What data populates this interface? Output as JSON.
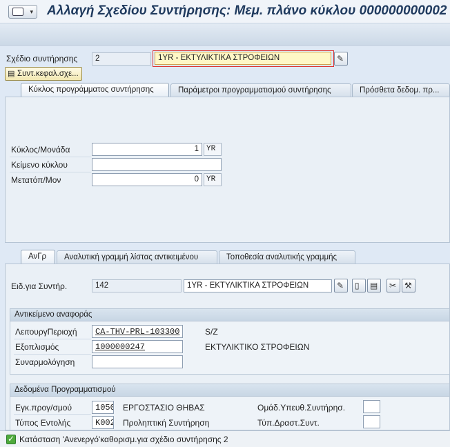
{
  "window": {
    "title": "Αλλαγή Σχεδίου Συντήρησης: Μεμ. πλάνο κύκλου 000000000002"
  },
  "header": {
    "plan_label": "Σχέδιο συντήρησης",
    "plan_number": "2",
    "plan_text": "1YR - ΕΚΤΥΛΙΚΤΙΚΑ ΣΤΡΟΦΕΙΩΝ",
    "header_button": "Συντ.κεφαλ.σχε..."
  },
  "tabs": [
    {
      "label": "Κύκλος προγράμματος συντήρησης"
    },
    {
      "label": "Παράμετροι προγραμματισμού συντήρησης"
    },
    {
      "label": "Πρόσθετα δεδομ. πρ..."
    }
  ],
  "cycle": {
    "cycle_label": "Κύκλος/Μονάδα",
    "cycle_value": "1",
    "cycle_unit": "YR",
    "text_label": "Κείμενο κύκλου",
    "text_value": "",
    "offset_label": "Μετατόπ/Μον",
    "offset_value": "0",
    "offset_unit": "YR"
  },
  "item_tabs": [
    {
      "label": "ΑνΓρ"
    },
    {
      "label": "Αναλυτική γραμμή λίστας αντικειμένου"
    },
    {
      "label": "Τοποθεσία αναλυτικής γραμμής"
    }
  ],
  "item": {
    "item_label": "Ειδ.για Συντήρ.",
    "item_number": "142",
    "item_text": "1YR - ΕΚΤΥΛΙΚΤΙΚΑ ΣΤΡΟΦΕΙΩΝ"
  },
  "reference": {
    "section_title": "Αντικείμενο αναφοράς",
    "floc_label": "ΛειτουργΠεριοχή",
    "floc_value": "CA-THV-PRL-103300",
    "floc_desc": "S/Z",
    "equip_label": "Εξοπλισμός",
    "equip_value": "1000000247",
    "equip_desc": "ΕΚΤΥΛΙΚΤΙΚΟ ΣΤΡΟΦΕΙΩΝ",
    "assembly_label": "Συναρμολόγηση",
    "assembly_value": ""
  },
  "planning": {
    "section_title": "Δεδομένα Προγραμματισμού",
    "plant_label": "Εγκ.προγ/σμού",
    "plant_value": "1050",
    "plant_desc": "ΕΡΓΟΣΤΑΣΙΟ ΘΗΒΑΣ",
    "group_label": "Ομάδ.Υπευθ.Συντήρησ.",
    "group_value": "",
    "order_type_label": "Τύπος Εντολής",
    "order_type_value": "K002",
    "order_type_desc": "Προληπτική Συντήρηση",
    "activity_label": "Τύπ.Δραστ.Συντ.",
    "activity_value": ""
  },
  "status": {
    "message": "Κατάσταση 'Ανενεργό'καθορισμ.για σχέδιο συντήρησης 2"
  }
}
